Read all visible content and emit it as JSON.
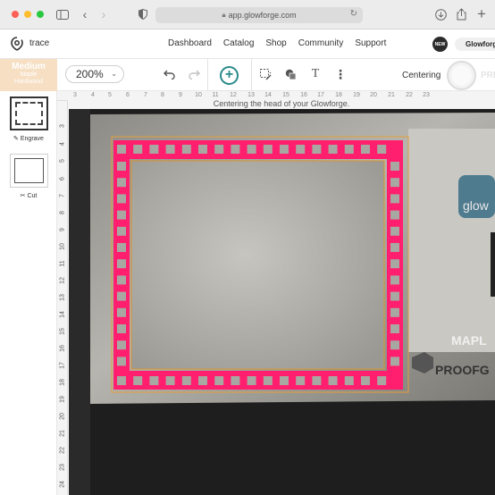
{
  "browser": {
    "url": "app.glowforge.com"
  },
  "header": {
    "design_name": "trace",
    "nav": [
      "Dashboard",
      "Catalog",
      "Shop",
      "Community",
      "Support"
    ],
    "new_badge": "NEW",
    "user_label": "Glowforge"
  },
  "toolbar": {
    "material_line1": "Medium",
    "material_line2": "Maple",
    "material_line3": "Hardwood",
    "zoom_value": "200%",
    "centering_label": "Centering",
    "print_label": "PRINT"
  },
  "status": {
    "message": "Centering the head of your Glowforge."
  },
  "operations": [
    {
      "label": "Engrave",
      "icon": "pencil-icon"
    },
    {
      "label": "Cut",
      "icon": "scissors-icon"
    }
  ],
  "rulers": {
    "horizontal": [
      "3",
      "4",
      "5",
      "6",
      "7",
      "8",
      "9",
      "10",
      "11",
      "12",
      "13",
      "14",
      "15",
      "16",
      "17",
      "18",
      "19",
      "20",
      "21",
      "22",
      "23"
    ],
    "vertical": [
      "3",
      "4",
      "5",
      "6",
      "7",
      "8",
      "9",
      "10",
      "11",
      "12",
      "13",
      "14",
      "15",
      "16",
      "17",
      "18",
      "19",
      "20",
      "21",
      "22",
      "23",
      "24"
    ]
  },
  "bed": {
    "material_label": "MAPL",
    "proofgrade_label": "PROOFG",
    "logo_text": "glow"
  },
  "colors": {
    "accent": "#2a8a8c",
    "engrave_frame": "#ff1f6e",
    "cut_line": "#e3a03a",
    "material": "#f6dfc3"
  }
}
